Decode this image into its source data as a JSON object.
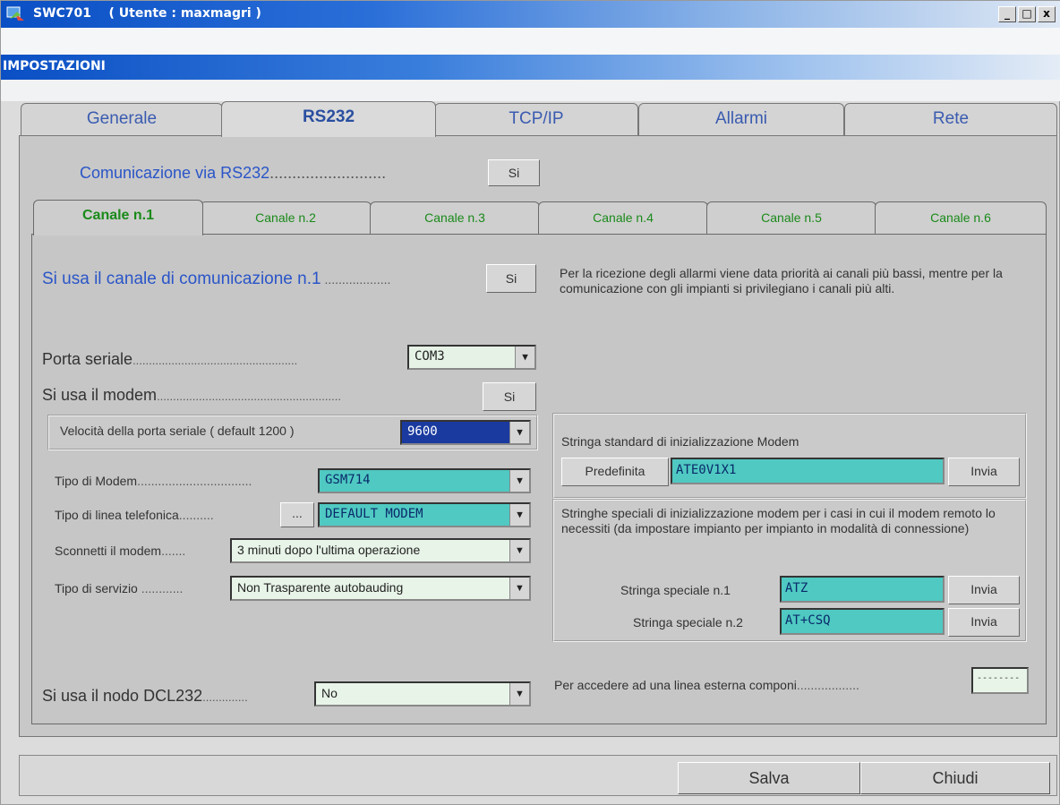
{
  "window": {
    "title": "SWC701    ( Utente : maxmagri )",
    "section_title": "IMPOSTAZIONI",
    "controls": [
      "_",
      "□",
      "x"
    ]
  },
  "main_tabs": [
    {
      "label": "Generale"
    },
    {
      "label": "RS232",
      "active": true
    },
    {
      "label": "TCP/IP"
    },
    {
      "label": "Allarmi"
    },
    {
      "label": "Rete"
    }
  ],
  "rs232": {
    "comm_label": "Comunicazione via RS232",
    "comm_value": "Si"
  },
  "channel_tabs": [
    {
      "label": "Canale n.1",
      "active": true
    },
    {
      "label": "Canale n.2"
    },
    {
      "label": "Canale n.3"
    },
    {
      "label": "Canale n.4"
    },
    {
      "label": "Canale n.5"
    },
    {
      "label": "Canale n.6"
    }
  ],
  "channel": {
    "use_channel_label": "Si usa il canale di comunicazione n.1",
    "use_channel_value": "Si",
    "note": "Per la ricezione degli allarmi viene data priorità ai canali più bassi, mentre per la comunicazione con gli impianti si privilegiano i canali più alti.",
    "serial_port_label": "Porta seriale",
    "serial_port_value": "COM3",
    "use_modem_label": "Si usa il modem",
    "use_modem_value": "Si",
    "speed_label": "Velocità della porta seriale ( default 1200 )",
    "speed_value": "9600",
    "modem_type_label": "Tipo di Modem",
    "modem_type_value": "GSM714",
    "line_type_label": "Tipo di linea telefonica",
    "line_type_button": "...",
    "line_type_value": "DEFAULT MODEM",
    "disconnect_label": "Sconnetti il modem",
    "disconnect_value": "3 minuti  dopo l'ultima operazione",
    "service_label": "Tipo di servizio",
    "service_value": "Non Trasparente autobauding",
    "dcl_label": "Si usa il nodo DCL232",
    "dcl_value": "No"
  },
  "init_standard": {
    "title": "Stringa standard di inizializzazione Modem",
    "default_button": "Predefinita",
    "value": "ATE0V1X1",
    "send_button": "Invia"
  },
  "init_special": {
    "description": "Stringhe speciali di inizializzazione modem per i casi in cui il modem remoto lo necessiti (da impostare impianto per impianto in modalità di connessione)",
    "string1_label": "Stringa speciale n.1",
    "string1_value": "ATZ",
    "string2_label": "Stringa speciale n.2",
    "string2_value": "AT+CSQ",
    "send_button": "Invia"
  },
  "external_line": {
    "label": "Per accedere ad una linea esterna componi",
    "value": "--------"
  },
  "footer": {
    "save": "Salva",
    "close": "Chiudi"
  },
  "colors": {
    "titlebar": "#0a4fc4",
    "teal_field": "#4fc9c2",
    "blue_label": "#2a55c8",
    "green_tab": "#1a8a1a"
  }
}
